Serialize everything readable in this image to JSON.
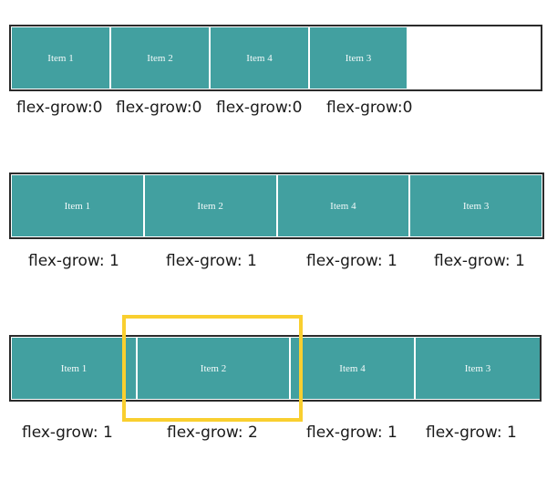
{
  "accent_colors": {
    "item_fill": "#42a0a0",
    "item_text": "#f4fafa",
    "container_border": "#2b2b2b",
    "highlight_border": "#f9cf2f"
  },
  "rows": [
    {
      "items": [
        "Item 1",
        "Item 2",
        "Item 4",
        "Item 3"
      ],
      "labels": [
        "flex-grow:0",
        "flex-grow:0",
        "flex-grow:0",
        "flex-grow:0"
      ],
      "flex_grow": [
        0,
        0,
        0,
        0
      ]
    },
    {
      "items": [
        "Item 1",
        "Item 2",
        "Item 4",
        "Item 3"
      ],
      "labels": [
        "flex-grow: 1",
        "flex-grow: 1",
        "flex-grow: 1",
        "flex-grow: 1"
      ],
      "flex_grow": [
        1,
        1,
        1,
        1
      ]
    },
    {
      "items": [
        "Item 1",
        "Item 2",
        "Item 4",
        "Item 3"
      ],
      "labels": [
        "flex-grow: 1",
        "flex-grow: 2",
        "flex-grow: 1",
        "flex-grow: 1"
      ],
      "flex_grow": [
        1,
        2,
        1,
        1
      ],
      "highlighted_item_index": 1
    }
  ]
}
